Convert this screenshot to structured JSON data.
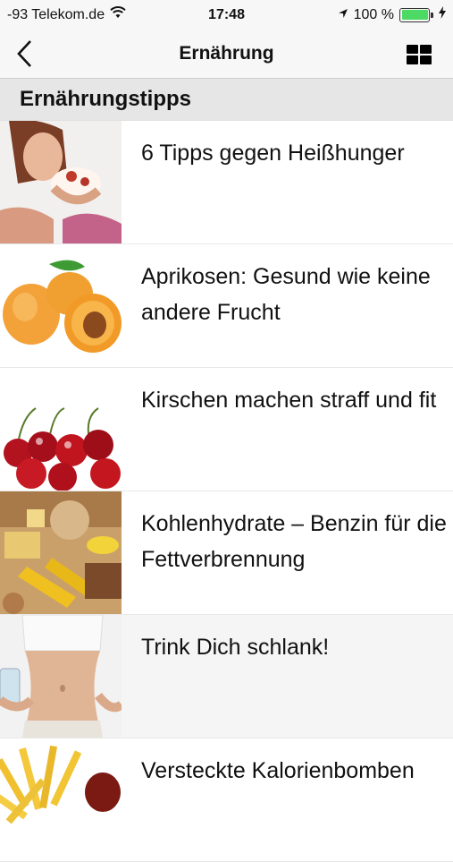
{
  "status": {
    "carrier": "-93 Telekom.de",
    "time": "17:48",
    "battery": "100 %",
    "icons": [
      "wifi-icon",
      "location-arrow-icon",
      "battery-icon",
      "charging-bolt-icon"
    ],
    "battery_level": 1.0,
    "battery_color": "#4cd964"
  },
  "nav": {
    "title": "Ernährung",
    "back_icon": "chevron-left-icon",
    "grid_icon": "grid-view-icon"
  },
  "section": {
    "title": "Ernährungstipps"
  },
  "articles": [
    {
      "title": "6 Tipps gegen Heißhunger",
      "image": "woman-eating-cake"
    },
    {
      "title": "Aprikosen: Gesund wie keine andere Frucht",
      "image": "apricots"
    },
    {
      "title": "Kirschen machen straff und fit",
      "image": "cherries"
    },
    {
      "title": "Kohlenhydrate – Benzin für die Fettverbrennung",
      "image": "carbohydrate-foods"
    },
    {
      "title": "Trink Dich schlank!",
      "image": "slim-waist-water"
    },
    {
      "title": "Versteckte Kalorienbomben",
      "image": "french-fries"
    }
  ]
}
